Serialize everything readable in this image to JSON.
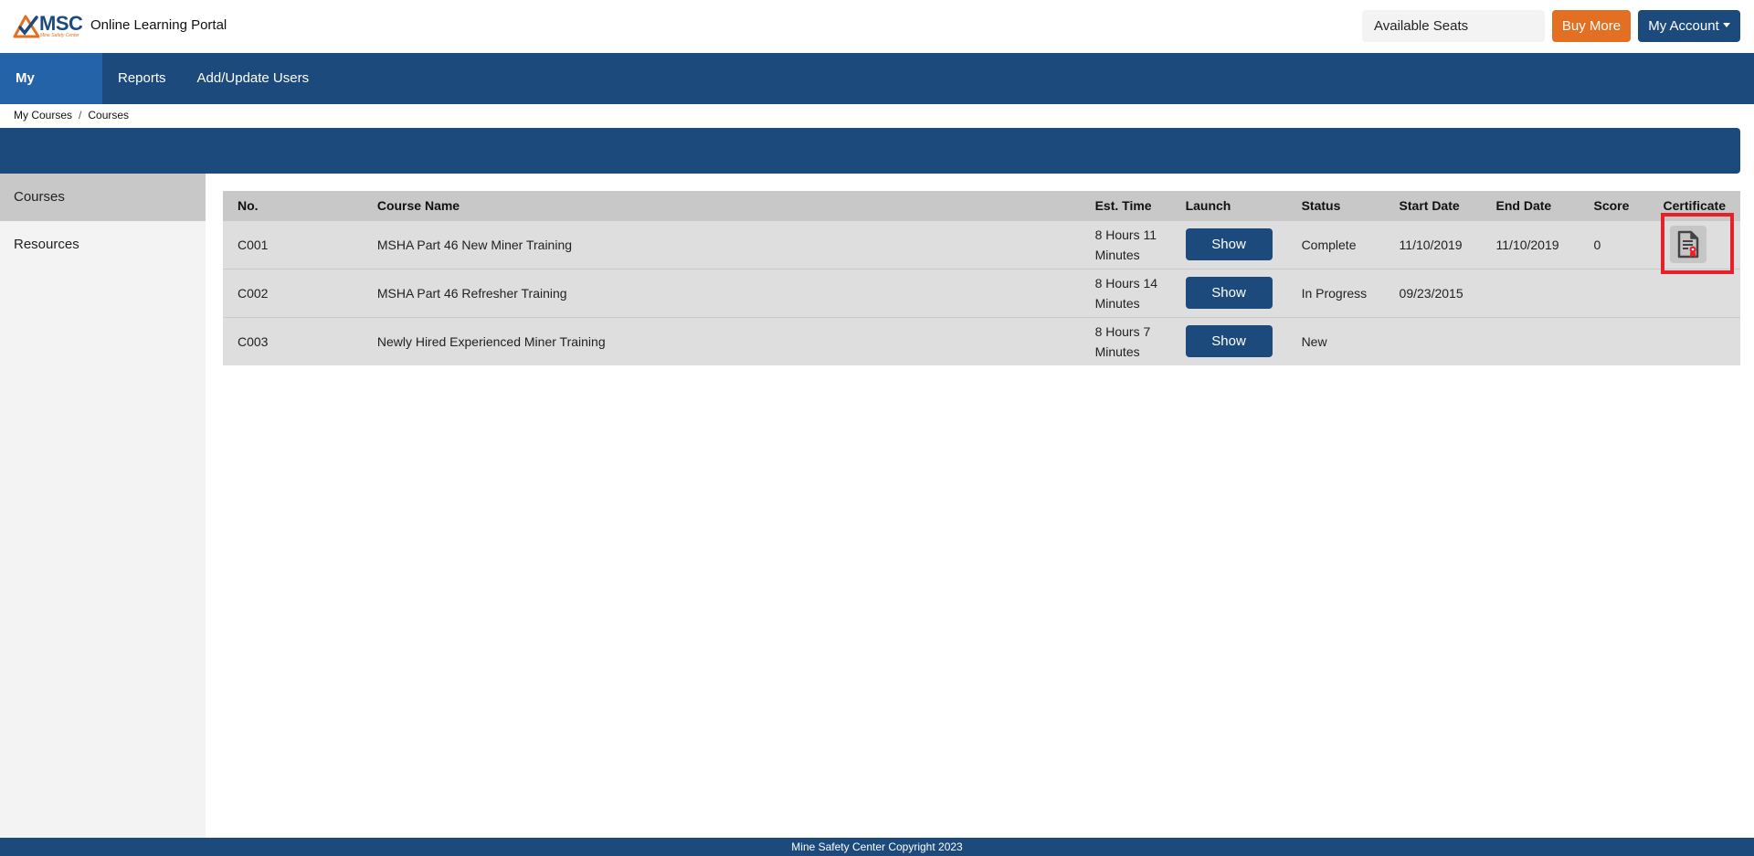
{
  "header": {
    "logo_text": "MSC",
    "logo_subtext": "Mine Safety Center",
    "portal_title": "Online Learning Portal",
    "available_seats_label": "Available Seats",
    "buy_more_label": "Buy More",
    "my_account_label": "My Account"
  },
  "nav": {
    "items": [
      {
        "label": "My Courses",
        "active": true
      },
      {
        "label": "Reports",
        "active": false
      },
      {
        "label": "Add/Update Users",
        "active": false
      }
    ]
  },
  "breadcrumb": {
    "items": [
      "My Courses",
      "Courses"
    ],
    "separator": "/"
  },
  "sidebar": {
    "items": [
      {
        "label": "Courses",
        "active": true
      },
      {
        "label": "Resources",
        "active": false
      }
    ]
  },
  "table": {
    "columns": [
      "No.",
      "Course Name",
      "Est. Time",
      "Launch",
      "Status",
      "Start Date",
      "End Date",
      "Score",
      "Certificate"
    ],
    "rows": [
      {
        "no": "C001",
        "name": "MSHA Part 46 New Miner Training",
        "time_line1": "8 Hours 11",
        "time_line2": "Minutes",
        "launch": "Show",
        "status": "Complete",
        "start": "11/10/2019",
        "end": "11/10/2019",
        "score": "0",
        "certificate": "certificate-icon"
      },
      {
        "no": "C002",
        "name": "MSHA Part 46 Refresher Training",
        "time_line1": "8 Hours 14",
        "time_line2": "Minutes",
        "launch": "Show",
        "status": "In Progress",
        "start": "09/23/2015",
        "end": "",
        "score": "",
        "certificate": ""
      },
      {
        "no": "C003",
        "name": "Newly Hired Experienced Miner Training",
        "time_line1": "8 Hours 7",
        "time_line2": "Minutes",
        "launch": "Show",
        "status": "New",
        "start": "",
        "end": "",
        "score": "",
        "certificate": ""
      }
    ]
  },
  "footer": {
    "text": "Mine Safety Center Copyright 2023"
  },
  "colors": {
    "primary": "#1c4a7c",
    "active_nav": "#2563a8",
    "accent": "#e36f22",
    "highlight": "#e8202a"
  }
}
